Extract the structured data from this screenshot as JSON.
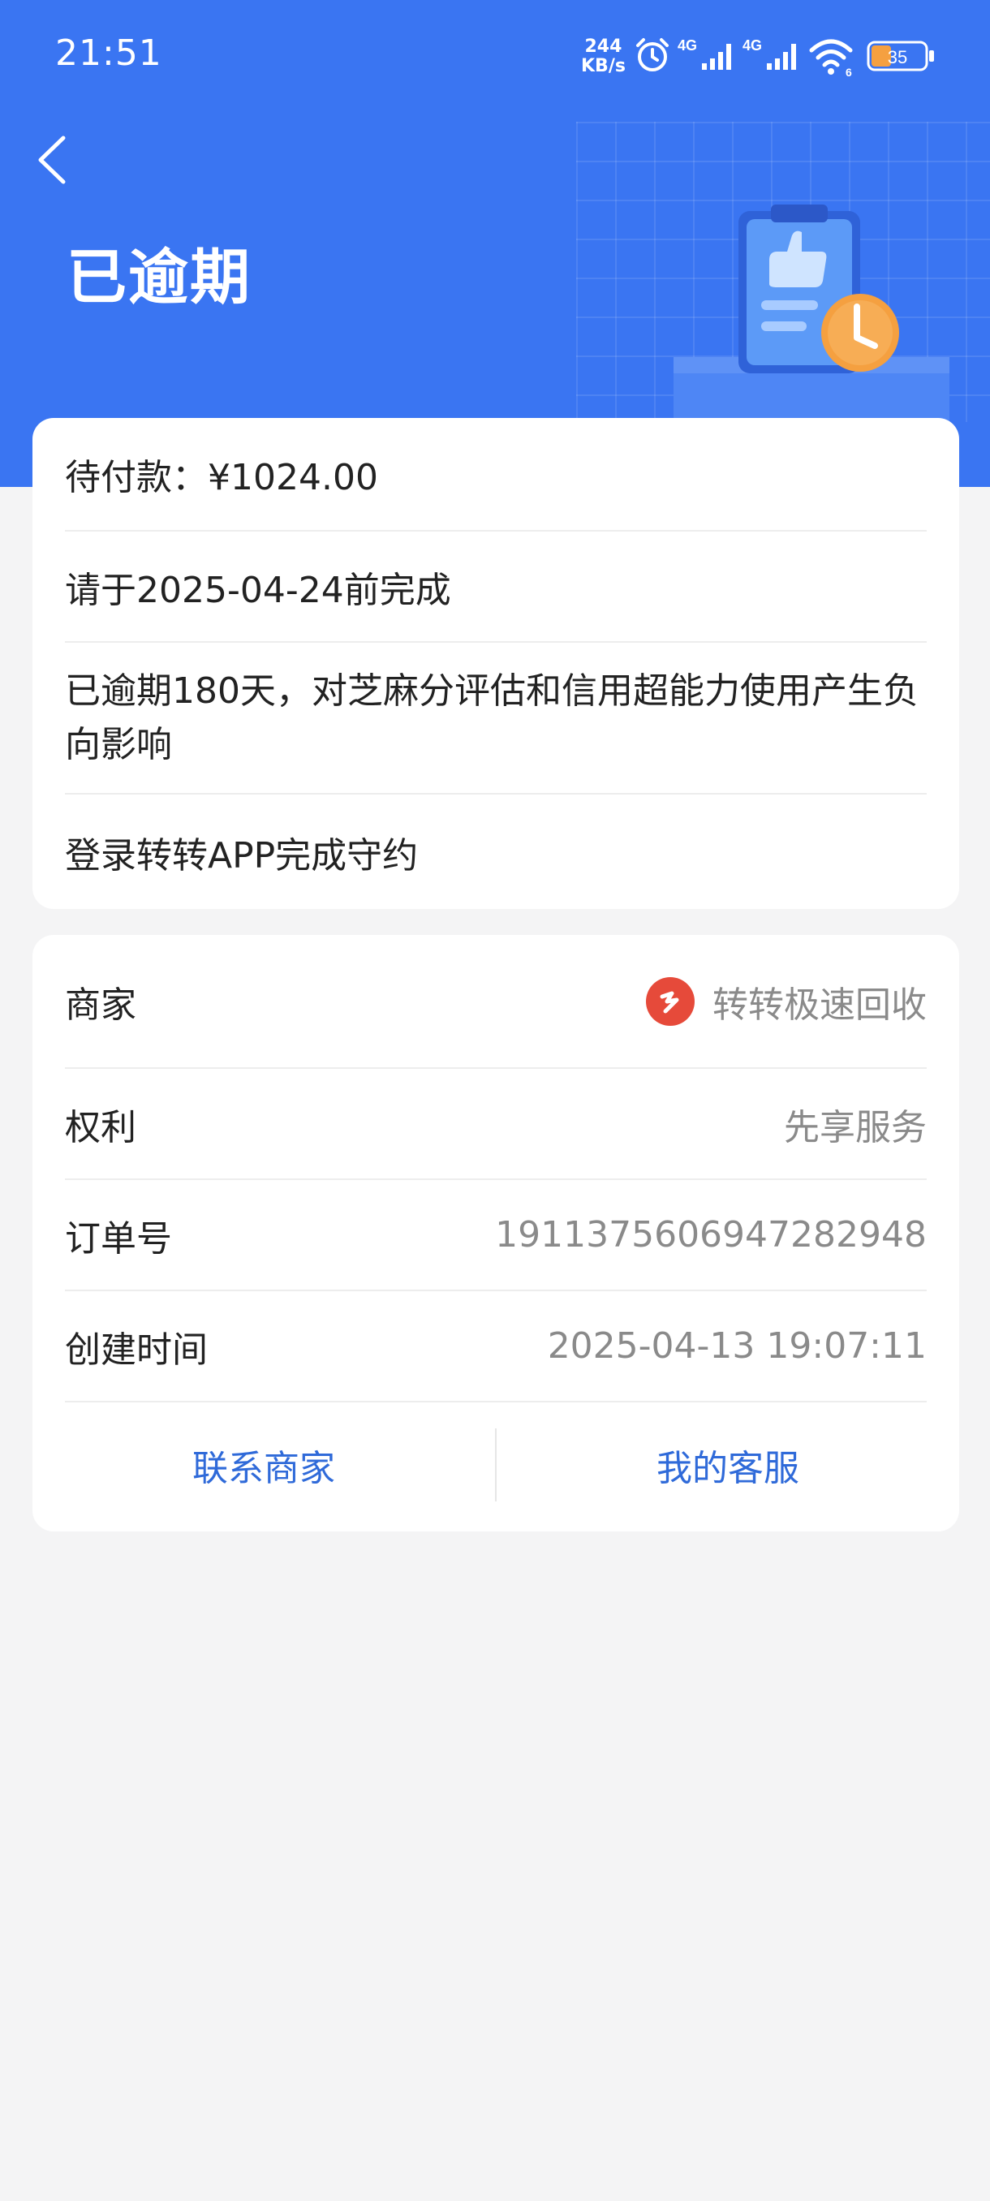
{
  "status_bar": {
    "time": "21:51",
    "net_speed_value": "244",
    "net_speed_unit": "KB/s",
    "sim1_label": "4G",
    "sim2_label": "4G",
    "wifi_label": "6",
    "battery_percent": "35"
  },
  "header": {
    "title": "已逾期",
    "back_icon": "chevron-left-icon"
  },
  "notice_card": {
    "amount": "待付款：¥1024.00",
    "deadline": "请于2025-04-24前完成",
    "overdue_text": "已逾期180天，对芝麻分评估和信用超能力使用产生负向影响",
    "instruction": "登录转转APP完成守约"
  },
  "order_card": {
    "merchant_label": "商家",
    "merchant_value": "转转极速回收",
    "rights_label": "权利",
    "rights_value": "先享服务",
    "order_no_label": "订单号",
    "order_no_value": "1911375606947282948",
    "created_label": "创建时间",
    "created_value": "2025-04-13 19:07:11",
    "contact_merchant": "联系商家",
    "my_service": "我的客服"
  },
  "colors": {
    "header_blue": "#3a75f2",
    "link_blue": "#2f6ad9",
    "merchant_logo_red": "#e64a3a",
    "clock_orange": "#f5a040"
  }
}
